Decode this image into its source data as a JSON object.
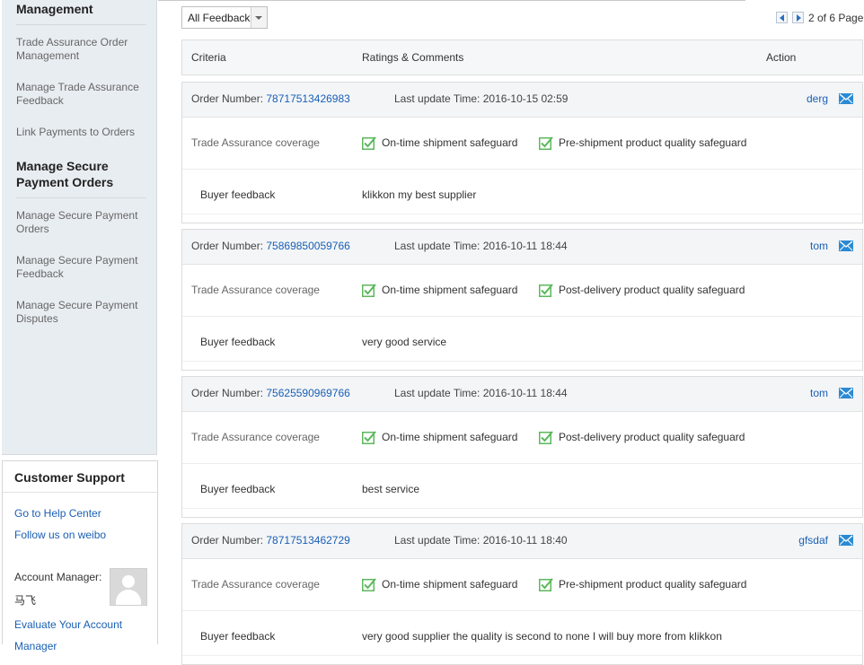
{
  "sidebar": {
    "section1_title": "Management",
    "items1": [
      "Trade Assurance Order Management",
      "Manage Trade Assurance Feedback",
      "Link Payments to Orders"
    ],
    "section2_title": "Manage Secure Payment Orders",
    "items2": [
      "Manage Secure Payment Orders",
      "Manage Secure Payment Feedback",
      "Manage Secure Payment Disputes"
    ]
  },
  "support": {
    "title": "Customer Support",
    "help_link": "Go to Help Center",
    "weibo_link": "Follow us on weibo",
    "account_manager_label": "Account Manager:",
    "account_manager_name": "马飞",
    "evaluate_link": "Evaluate Your Account Manager"
  },
  "filter": {
    "selected": "All Feedback"
  },
  "pager": {
    "text": "2 of 6 Page"
  },
  "table": {
    "headers": {
      "criteria": "Criteria",
      "ratings": "Ratings & Comments",
      "action": "Action"
    }
  },
  "labels": {
    "order_number": "Order Number:",
    "last_update": "Last update Time:",
    "coverage": "Trade Assurance coverage",
    "buyer_feedback": "Buyer feedback"
  },
  "cards": [
    {
      "order_number": "78717513426983",
      "last_update": "2016-10-15 02:59",
      "buyer": "derg",
      "coverage": [
        "On-time shipment safeguard",
        "Pre-shipment product quality safeguard"
      ],
      "feedback": "klikkon my best supplier"
    },
    {
      "order_number": "75869850059766",
      "last_update": "2016-10-11 18:44",
      "buyer": "tom",
      "coverage": [
        "On-time shipment safeguard",
        "Post-delivery product quality safeguard"
      ],
      "feedback": "very good service"
    },
    {
      "order_number": "75625590969766",
      "last_update": "2016-10-11 18:44",
      "buyer": "tom",
      "coverage": [
        "On-time shipment safeguard",
        "Post-delivery product quality safeguard"
      ],
      "feedback": "best service"
    },
    {
      "order_number": "78717513462729",
      "last_update": "2016-10-11 18:40",
      "buyer": "gfsdaf",
      "coverage": [
        "On-time shipment safeguard",
        "Pre-shipment product quality safeguard"
      ],
      "feedback": "very good supplier the quality is second to none I will buy more from klikkon"
    }
  ],
  "colors": {
    "link": "#1a5fb4",
    "check": "#5cb85c",
    "mail": "#2a8ad4"
  }
}
